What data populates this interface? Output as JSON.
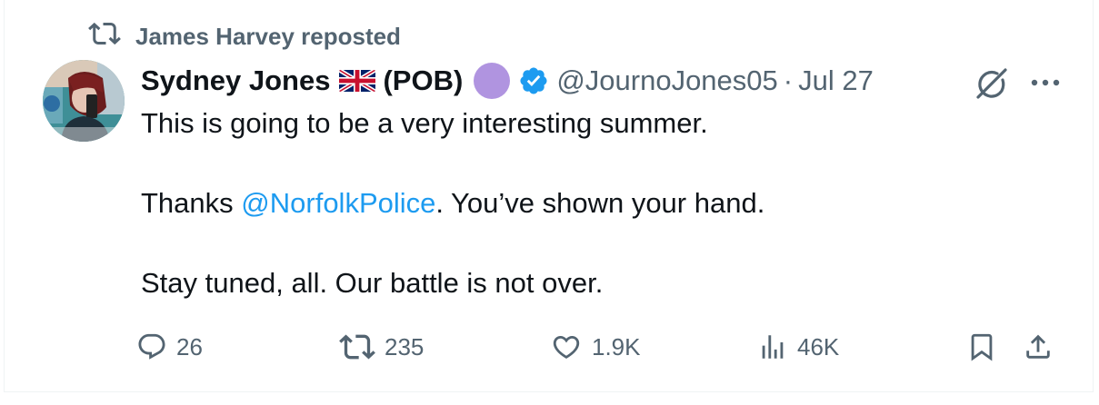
{
  "repost": {
    "icon": "repost-icon",
    "text": "James Harvey reposted"
  },
  "tweet": {
    "author": {
      "display_name": "Sydney Jones",
      "flag_icon": "uk-flag-icon",
      "suffix": "(POB)",
      "purple_circle_color": "#b094e0",
      "verified_icon": "verified-badge-icon",
      "verified_color": "#1d9bf0",
      "handle": "@JournoJones05",
      "separator": "·",
      "date": "Jul 27"
    },
    "body": {
      "line1": "This is going to be a very interesting summer.",
      "line2_prefix": "Thanks ",
      "line2_mention": "@NorfolkPolice",
      "line2_suffix": ". You’ve shown your hand.",
      "line3": "Stay tuned, all. Our battle is not over."
    },
    "actions": {
      "replies": "26",
      "reposts": "235",
      "likes": "1.9K",
      "views": "46K"
    },
    "icons": {
      "grok": "grok-icon",
      "more": "more-options-icon",
      "reply": "reply-icon",
      "repost": "repost-icon",
      "like": "like-heart-icon",
      "views": "views-analytics-icon",
      "bookmark": "bookmark-icon",
      "share": "share-icon"
    },
    "colors": {
      "text": "#0f1419",
      "secondary": "#536471",
      "link": "#1d9bf0"
    }
  }
}
